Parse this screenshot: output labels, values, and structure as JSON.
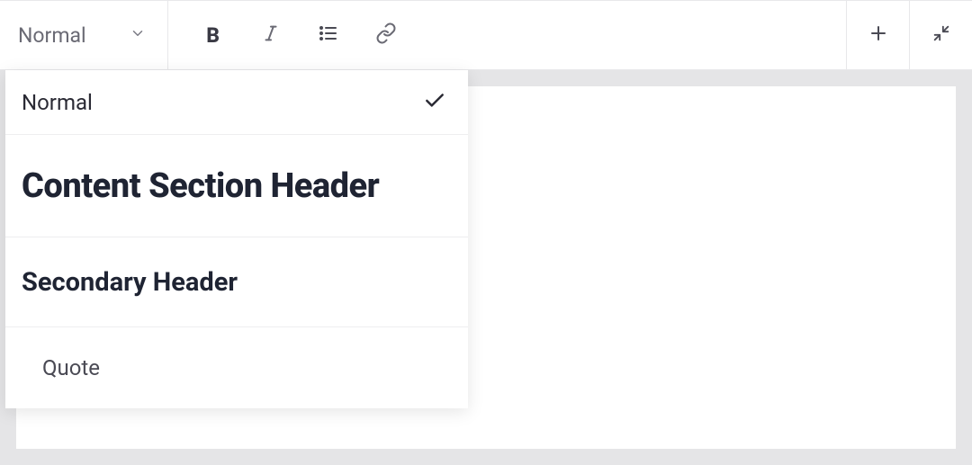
{
  "toolbar": {
    "style_selector": {
      "current_label": "Normal"
    }
  },
  "dropdown": {
    "items": [
      {
        "label": "Normal",
        "selected": true
      },
      {
        "label": "Content Section Header",
        "selected": false
      },
      {
        "label": "Secondary Header",
        "selected": false
      },
      {
        "label": "Quote",
        "selected": false
      }
    ]
  }
}
